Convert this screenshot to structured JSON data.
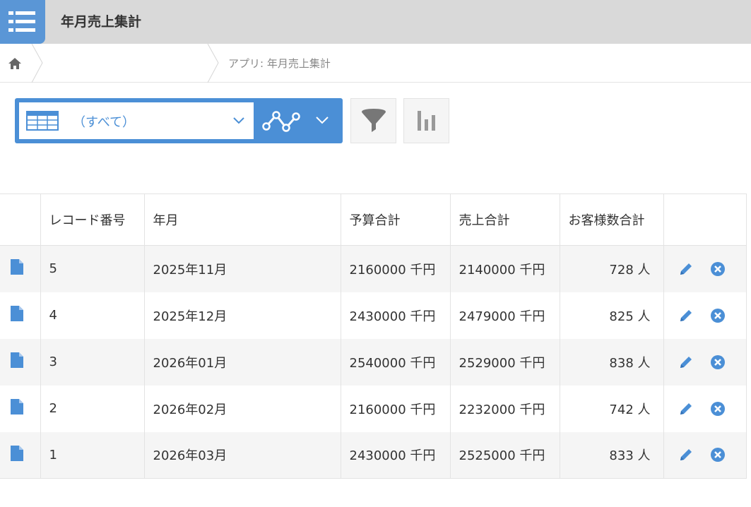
{
  "header": {
    "title": "年月売上集計"
  },
  "breadcrumb": {
    "app_label": "アプリ: 年月売上集計"
  },
  "toolbar": {
    "view_label": "（すべて）"
  },
  "table": {
    "columns": [
      "",
      "レコード番号",
      "年月",
      "予算合計",
      "売上合計",
      "お客様数合計",
      ""
    ],
    "rows": [
      {
        "record_no": "5",
        "year_month": "2025年11月",
        "budget": "2160000 千円",
        "sales": "2140000 千円",
        "customers": "728 人"
      },
      {
        "record_no": "4",
        "year_month": "2025年12月",
        "budget": "2430000 千円",
        "sales": "2479000 千円",
        "customers": "825 人"
      },
      {
        "record_no": "3",
        "year_month": "2026年01月",
        "budget": "2540000 千円",
        "sales": "2529000 千円",
        "customers": "838 人"
      },
      {
        "record_no": "2",
        "year_month": "2026年02月",
        "budget": "2160000 千円",
        "sales": "2232000 千円",
        "customers": "742 人"
      },
      {
        "record_no": "1",
        "year_month": "2026年03月",
        "budget": "2430000 千円",
        "sales": "2525000 千円",
        "customers": "833 人"
      }
    ]
  },
  "icons": {
    "app": "list-icon",
    "home": "home-icon",
    "view": "table-view-icon",
    "graph": "graph-icon",
    "filter": "filter-icon",
    "chart": "bar-chart-icon",
    "record": "document-icon",
    "edit": "pencil-icon",
    "delete": "close-circle-icon"
  },
  "colors": {
    "accent": "#4b8fd6",
    "header_bg": "#d9d9d9",
    "row_alt": "#f5f5f5"
  }
}
